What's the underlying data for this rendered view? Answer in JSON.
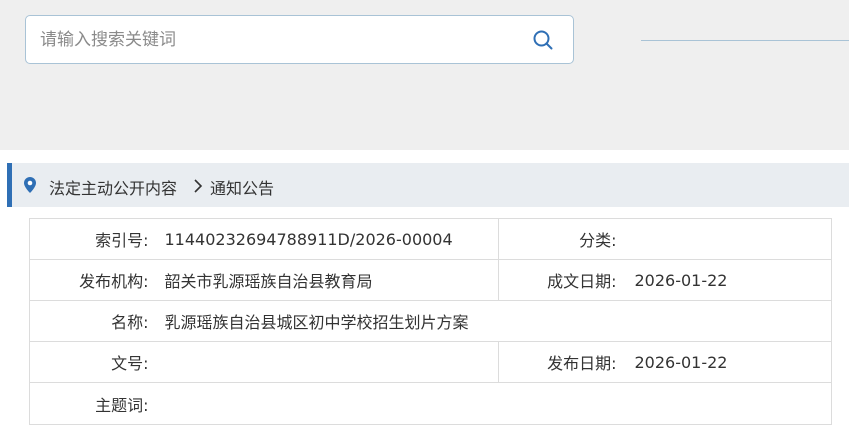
{
  "search": {
    "placeholder": "请输入搜索关键词",
    "value": ""
  },
  "breadcrumb": {
    "parent": "法定主动公开内容",
    "current": "通知公告"
  },
  "info": {
    "index_label": "索引号:",
    "index_value": "11440232694788911D/2026-00004",
    "category_label": "分类:",
    "category_value": "",
    "publisher_label": "发布机构:",
    "publisher_value": "韶关市乳源瑶族自治县教育局",
    "doc_date_label": "成文日期:",
    "doc_date_value": "2026-01-22",
    "name_label": "名称:",
    "name_value": "乳源瑶族自治县城区初中学校招生划片方案",
    "doc_no_label": "文号:",
    "doc_no_value": "",
    "pub_date_label": "发布日期:",
    "pub_date_value": "2026-01-22",
    "subject_label": "主题词:",
    "subject_value": ""
  },
  "colors": {
    "accent": "#2f6fb5",
    "search_border": "#a9c3d6",
    "header_bg": "#efefef",
    "breadcrumb_bg": "#e9edf1"
  }
}
